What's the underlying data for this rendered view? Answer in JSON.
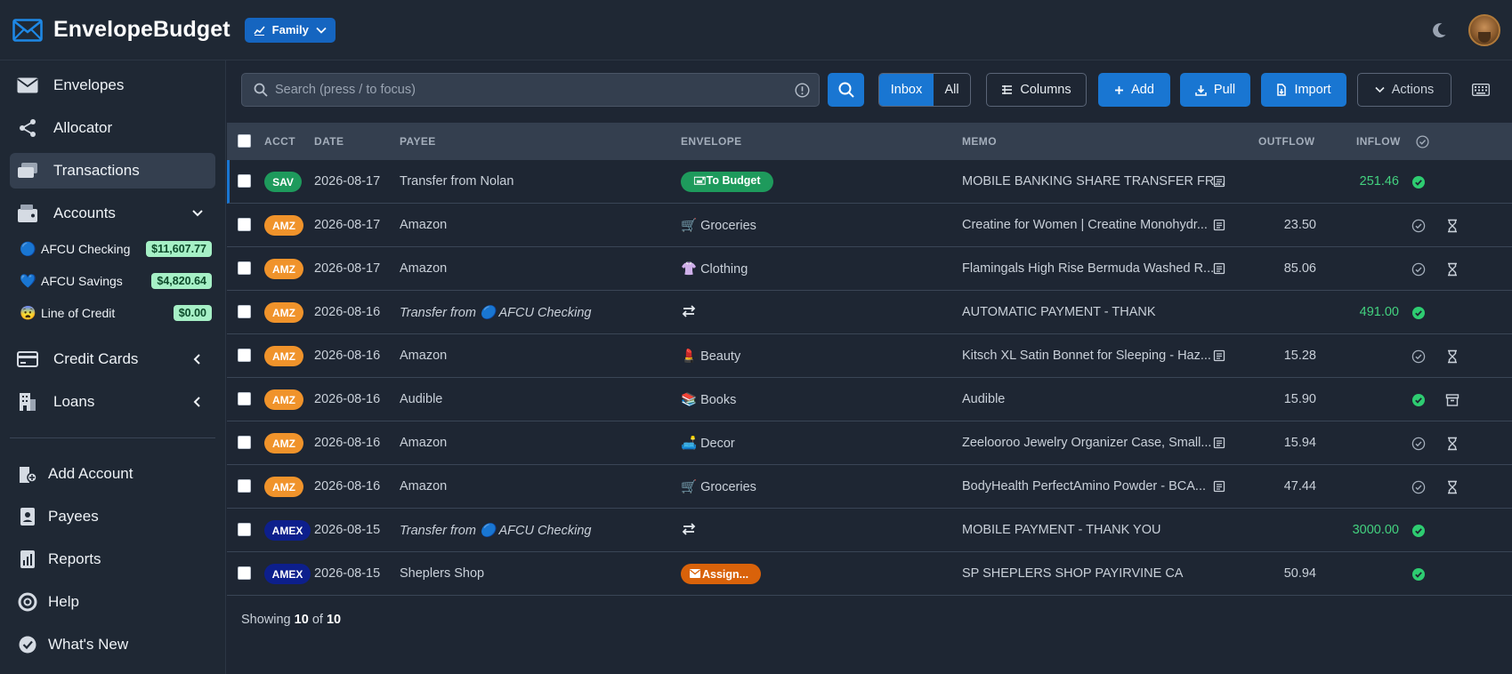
{
  "app": {
    "title": "EnvelopeBudget",
    "budget_selector": "Family"
  },
  "sidebar": {
    "envelopes": "Envelopes",
    "allocator": "Allocator",
    "transactions": "Transactions",
    "accounts": "Accounts",
    "account_list": [
      {
        "emoji": "🔵",
        "name": "AFCU Checking",
        "balance": "$11,607.77"
      },
      {
        "emoji": "💙",
        "name": "AFCU Savings",
        "balance": "$4,820.64"
      },
      {
        "emoji": "😨",
        "name": "Line of Credit",
        "balance": "$0.00"
      }
    ],
    "credit_cards": "Credit Cards",
    "loans": "Loans",
    "add_account": "Add Account",
    "payees": "Payees",
    "reports": "Reports",
    "help": "Help",
    "whats_new": "What's New"
  },
  "toolbar": {
    "search_placeholder": "Search (press / to focus)",
    "inbox": "Inbox",
    "all": "All",
    "columns": "Columns",
    "add": "Add",
    "pull": "Pull",
    "import": "Import",
    "actions": "Actions"
  },
  "table": {
    "headers": {
      "acct": "ACCT",
      "date": "DATE",
      "payee": "PAYEE",
      "envelope": "ENVELOPE",
      "memo": "MEMO",
      "outflow": "OUTFLOW",
      "inflow": "INFLOW"
    },
    "rows": [
      {
        "acct": "SAV",
        "date": "2026-08-17",
        "payee_main": "Transfer from Nolan",
        "payee_acct": "",
        "envelope_type": "badge-green",
        "envelope_emoji": "",
        "envelope": "🖃To Budget",
        "memo": "MOBILE BANKING SHARE TRANSFER FR...",
        "memo_icon": true,
        "outflow": "",
        "inflow": "251.46",
        "status": "check-filled",
        "action": ""
      },
      {
        "acct": "AMZ",
        "date": "2026-08-17",
        "payee_main": "Amazon",
        "payee_acct": "",
        "envelope_type": "text",
        "envelope_emoji": "🛒",
        "envelope": "Groceries",
        "memo": "Creatine for Women | Creatine Monohydr...",
        "memo_icon": true,
        "outflow": "23.50",
        "inflow": "",
        "status": "check-outline",
        "action": "hourglass"
      },
      {
        "acct": "AMZ",
        "date": "2026-08-17",
        "payee_main": "Amazon",
        "payee_acct": "",
        "envelope_type": "text",
        "envelope_emoji": "👚",
        "envelope": "Clothing",
        "memo": "Flamingals High Rise Bermuda Washed R...",
        "memo_icon": true,
        "outflow": "85.06",
        "inflow": "",
        "status": "check-outline",
        "action": "hourglass"
      },
      {
        "acct": "AMZ",
        "date": "2026-08-16",
        "payee_main": "Transfer from ",
        "payee_acct": "🔵 AFCU Checking",
        "envelope_type": "transfer",
        "envelope_emoji": "",
        "envelope": "",
        "memo": "AUTOMATIC PAYMENT - THANK",
        "memo_icon": false,
        "outflow": "",
        "inflow": "491.00",
        "status": "check-filled",
        "action": ""
      },
      {
        "acct": "AMZ",
        "date": "2026-08-16",
        "payee_main": "Amazon",
        "payee_acct": "",
        "envelope_type": "text",
        "envelope_emoji": "💄",
        "envelope": "Beauty",
        "memo": "Kitsch XL Satin Bonnet for Sleeping - Haz...",
        "memo_icon": true,
        "outflow": "15.28",
        "inflow": "",
        "status": "check-outline",
        "action": "hourglass"
      },
      {
        "acct": "AMZ",
        "date": "2026-08-16",
        "payee_main": "Audible",
        "payee_acct": "",
        "envelope_type": "text",
        "envelope_emoji": "📚",
        "envelope": "Books",
        "memo": "Audible",
        "memo_icon": false,
        "outflow": "15.90",
        "inflow": "",
        "status": "check-filled",
        "action": "archive"
      },
      {
        "acct": "AMZ",
        "date": "2026-08-16",
        "payee_main": "Amazon",
        "payee_acct": "",
        "envelope_type": "text",
        "envelope_emoji": "🛋️",
        "envelope": "Decor",
        "memo": "Zeelooroo Jewelry Organizer Case, Small...",
        "memo_icon": true,
        "outflow": "15.94",
        "inflow": "",
        "status": "check-outline",
        "action": "hourglass"
      },
      {
        "acct": "AMZ",
        "date": "2026-08-16",
        "payee_main": "Amazon",
        "payee_acct": "",
        "envelope_type": "text",
        "envelope_emoji": "🛒",
        "envelope": "Groceries",
        "memo": "BodyHealth PerfectAmino Powder - BCA...",
        "memo_icon": true,
        "outflow": "47.44",
        "inflow": "",
        "status": "check-outline",
        "action": "hourglass"
      },
      {
        "acct": "AMEX",
        "date": "2026-08-15",
        "payee_main": "Transfer from ",
        "payee_acct": "🔵 AFCU Checking",
        "envelope_type": "transfer",
        "envelope_emoji": "",
        "envelope": "",
        "memo": "MOBILE PAYMENT - THANK YOU",
        "memo_icon": false,
        "outflow": "",
        "inflow": "3000.00",
        "status": "check-filled",
        "action": ""
      },
      {
        "acct": "AMEX",
        "date": "2026-08-15",
        "payee_main": "Sheplers Shop",
        "payee_acct": "",
        "envelope_type": "badge-orange",
        "envelope_emoji": "",
        "envelope": "Assign...",
        "memo": "SP SHEPLERS SHOP PAYIRVINE CA",
        "memo_icon": false,
        "outflow": "50.94",
        "inflow": "",
        "status": "check-filled",
        "action": ""
      }
    ]
  },
  "footer": {
    "prefix": "Showing",
    "shown": "10",
    "of": "of",
    "total": "10"
  },
  "colors": {
    "accent": "#1976d2",
    "success": "#1e9a5c",
    "amazon": "#f0932b",
    "amex": "#0d1f8c",
    "inflow": "#43d17f"
  }
}
